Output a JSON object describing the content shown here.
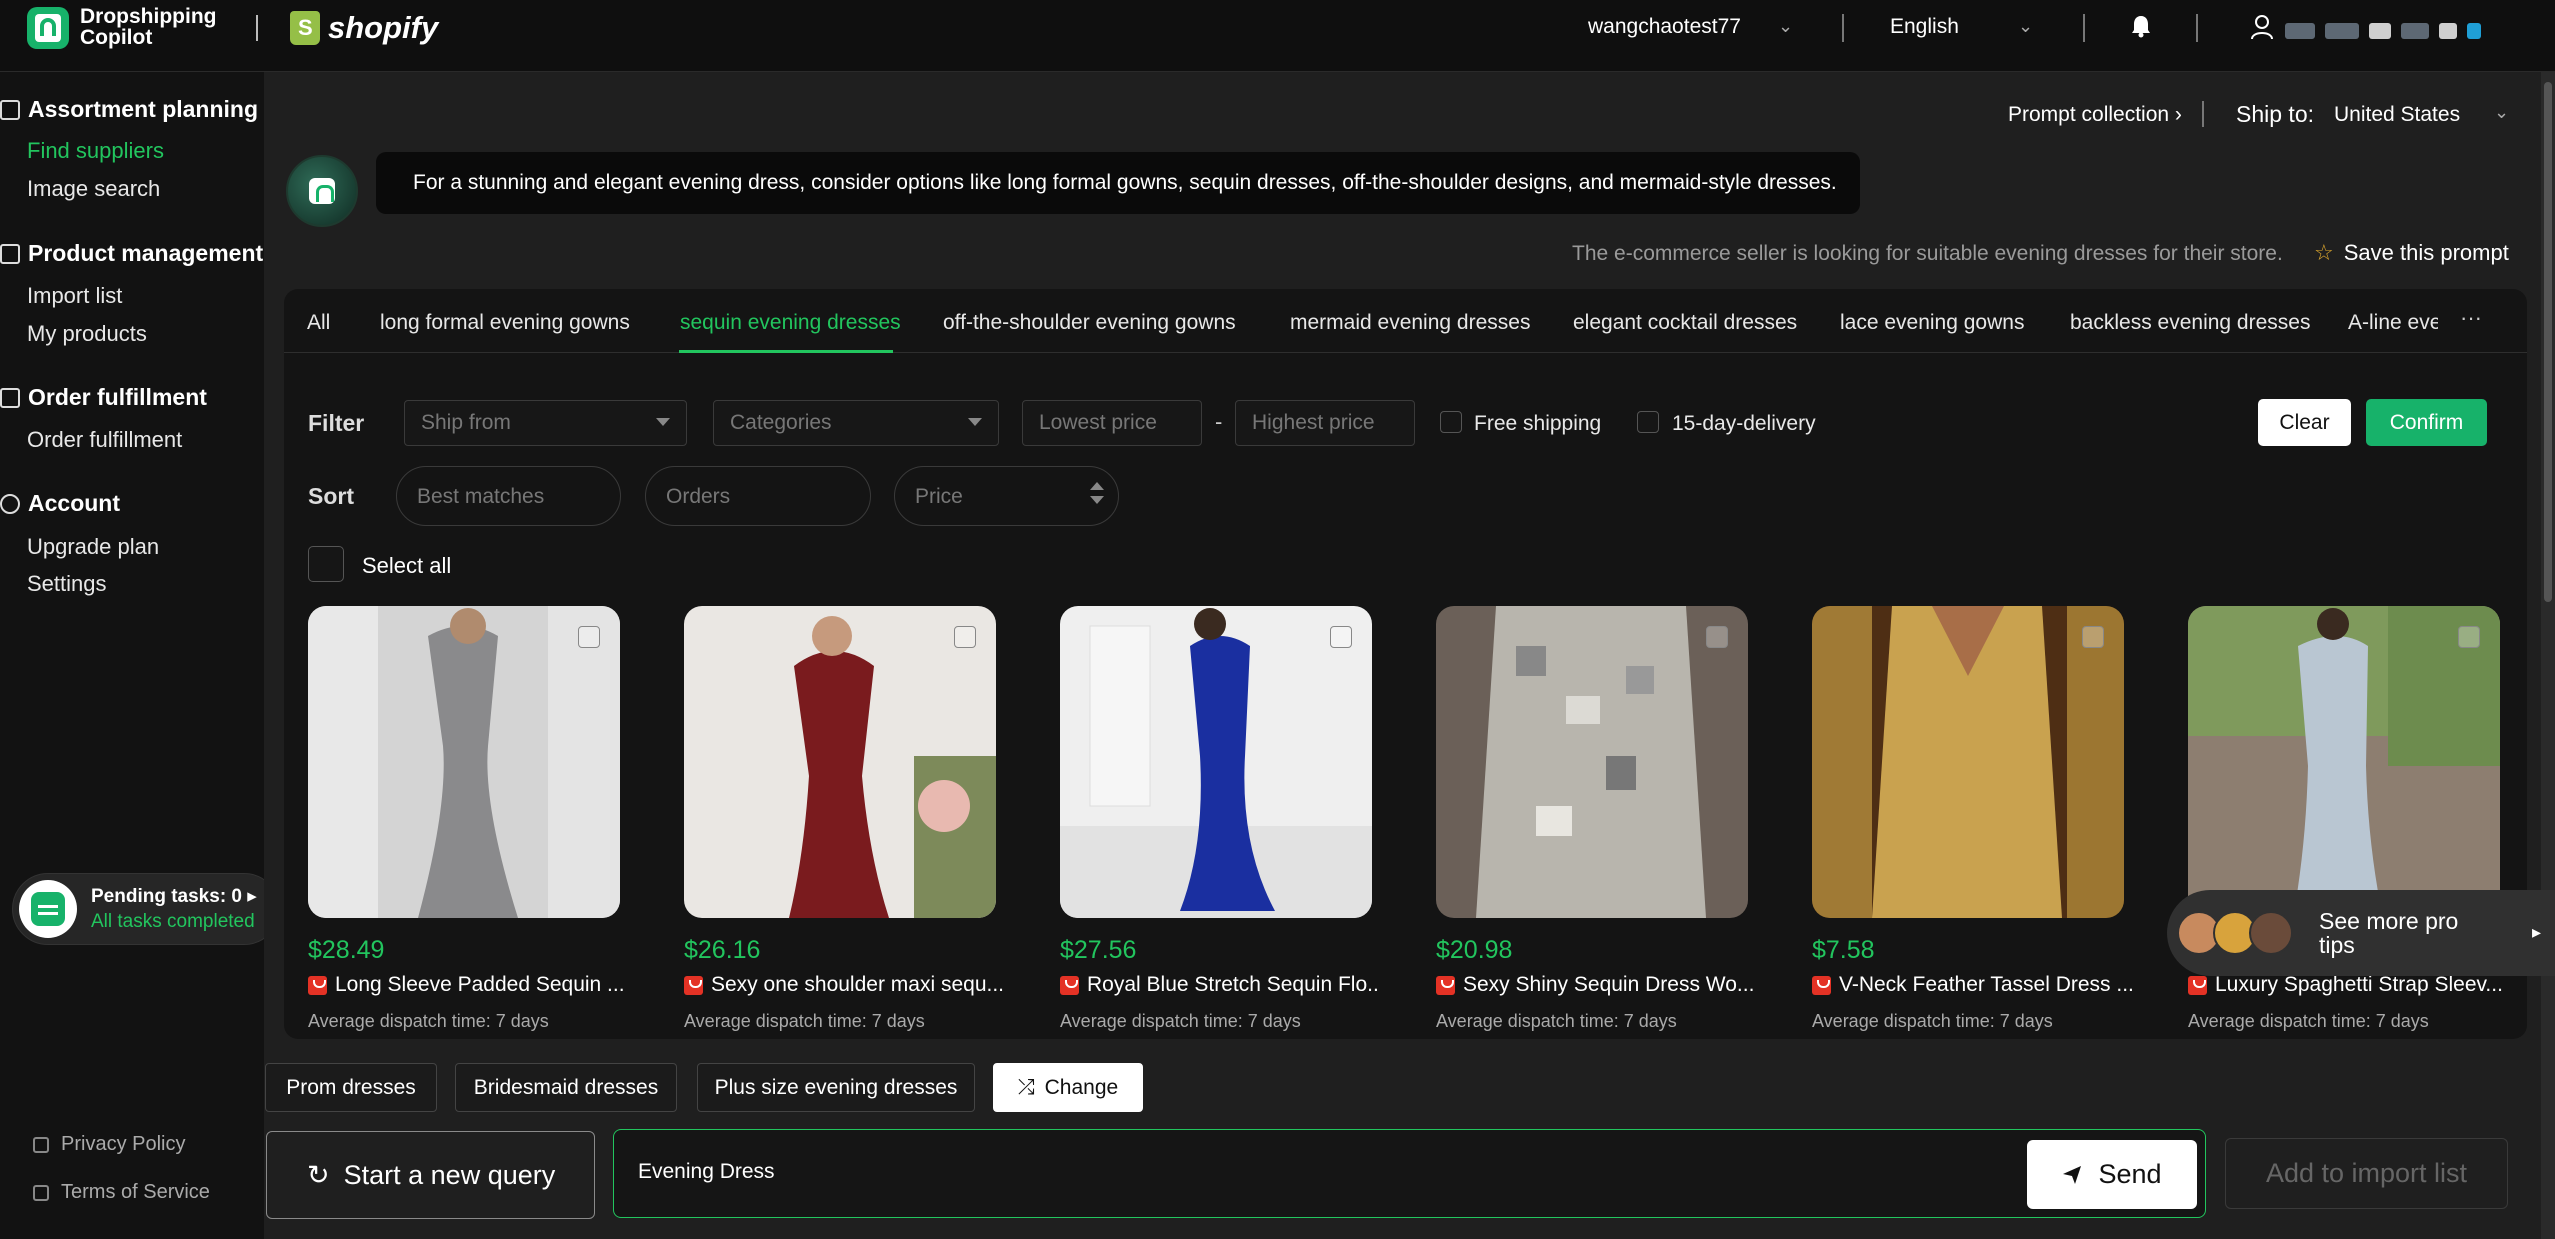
{
  "app": {
    "name_line1": "Dropshipping",
    "name_line2": "Copilot",
    "partner": "shopify"
  },
  "topbar": {
    "username": "wangchaotest77",
    "language": "English",
    "icons": [
      "chevron-down-icon",
      "bell-icon",
      "user-icon"
    ]
  },
  "sidebar": {
    "sections": [
      {
        "title": "Assortment planning",
        "icon": "store-icon",
        "items": [
          "Find suppliers",
          "Image search"
        ]
      },
      {
        "title": "Product management",
        "icon": "shirt-icon",
        "items": [
          "Import list",
          "My products"
        ]
      },
      {
        "title": "Order fulfillment",
        "icon": "box-icon",
        "items": [
          "Order fulfillment"
        ]
      },
      {
        "title": "Account",
        "icon": "gear-icon",
        "items": [
          "Upgrade plan",
          "Settings"
        ]
      }
    ],
    "active_item": "Find suppliers",
    "pending": {
      "title": "Pending tasks: 0",
      "status": "All tasks completed"
    },
    "footer": [
      "Privacy Policy",
      "Terms of Service"
    ]
  },
  "header": {
    "prompt_collection": "Prompt collection",
    "ship_to_label": "Ship to:",
    "ship_to_value": "United States"
  },
  "assistant_message": "For a stunning and elegant evening dress, consider options like long formal gowns, sequin dresses, off-the-shoulder designs, and mermaid-style dresses.",
  "description": "The e-commerce seller is looking for suitable evening dresses for their store.",
  "save_prompt": "Save this prompt",
  "tabs": [
    "All",
    "long formal evening gowns",
    "sequin evening dresses",
    "off-the-shoulder evening gowns",
    "mermaid evening dresses",
    "elegant cocktail dresses",
    "lace evening gowns",
    "backless evening dresses",
    "A-line eve"
  ],
  "active_tab": "sequin evening dresses",
  "filter": {
    "label": "Filter",
    "ship_from_placeholder": "Ship from",
    "categories_placeholder": "Categories",
    "lowest_price_placeholder": "Lowest price",
    "separator": "-",
    "highest_price_placeholder": "Highest price",
    "free_shipping": "Free shipping",
    "fast_delivery": "15-day-delivery",
    "clear": "Clear",
    "confirm": "Confirm"
  },
  "sort": {
    "label": "Sort",
    "options": [
      "Best matches",
      "Orders",
      "Price"
    ]
  },
  "select_all": "Select all",
  "products": [
    {
      "price": "$28.49",
      "title": "Long Sleeve Padded Sequin ...",
      "dispatch": "Average dispatch time: 7 days",
      "color": "#8c8c8e",
      "bg": "#d8d8d8"
    },
    {
      "price": "$26.16",
      "title": "Sexy one shoulder maxi sequ...",
      "dispatch": "Average dispatch time: 7 days",
      "color": "#7a1b1e",
      "bg": "#e9e6e2"
    },
    {
      "price": "$27.56",
      "title": "Royal Blue Stretch Sequin Flo...",
      "dispatch": "Average dispatch time: 7 days",
      "color": "#1a2fa0",
      "bg": "#eeeeee"
    },
    {
      "price": "$20.98",
      "title": "Sexy Shiny Sequin Dress Wo...",
      "dispatch": "Average dispatch time: 7 days",
      "color": "#b8b5ad",
      "bg": "#6e625a"
    },
    {
      "price": "$7.58",
      "title": "V-Neck Feather Tassel Dress ...",
      "dispatch": "Average dispatch time: 7 days",
      "color": "#c9a24f",
      "bg": "#5a3518"
    },
    {
      "price": "",
      "title": "Luxury Spaghetti Strap Sleev...",
      "dispatch": "Average dispatch time: 7 days",
      "color": "#b9c6d2",
      "bg": "#8a7a6c"
    }
  ],
  "pro_tips": "See more pro tips",
  "suggestions": [
    "Prom dresses",
    "Bridesmaid dresses",
    "Plus size evening dresses"
  ],
  "change": "Change",
  "new_query": "Start a new query",
  "query_value": "Evening Dress",
  "send": "Send",
  "add_to_import": "Add to import list"
}
